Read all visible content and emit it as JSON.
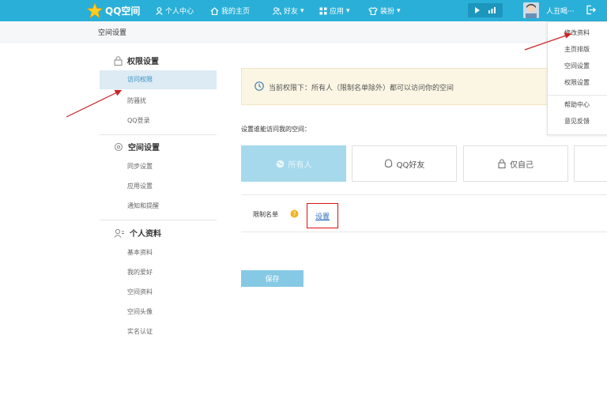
{
  "topbar": {
    "logo_text": "QQ空间",
    "nav": [
      {
        "label": "个人中心",
        "icon": "person-icon"
      },
      {
        "label": "我的主页",
        "icon": "home-icon"
      },
      {
        "label": "好友",
        "icon": "friends-icon"
      },
      {
        "label": "应用",
        "icon": "apps-grid-icon"
      },
      {
        "label": "装扮",
        "icon": "shirt-icon"
      }
    ],
    "username": "人丑喝···",
    "colors": {
      "bar": "#2ab0d8"
    }
  },
  "subheader": {
    "title": "空间设置"
  },
  "dropdown": {
    "items": [
      "修改资料",
      "主页排版",
      "空间设置",
      "权限设置",
      "帮助中心",
      "意见反馈"
    ]
  },
  "sidebar": {
    "groups": [
      {
        "title": "权限设置",
        "icon": "lock-icon",
        "items": [
          "访问权限",
          "防骚扰",
          "QQ登录"
        ]
      },
      {
        "title": "空间设置",
        "icon": "settings-icon",
        "items": [
          "同步设置",
          "应用设置",
          "通知和提醒"
        ]
      },
      {
        "title": "个人资料",
        "icon": "profile-icon",
        "items": [
          "基本资料",
          "我的爱好",
          "空间资料",
          "空间头像",
          "实名认证"
        ]
      }
    ],
    "active_item": "访问权限"
  },
  "main": {
    "notice": "当前权限下：所有人（限制名单除外）都可以访问你的空间",
    "section_label": "设置谁能访问我的空间：",
    "options": [
      {
        "label": "所有人",
        "icon": "globe-icon",
        "selected": true
      },
      {
        "label": "QQ好友",
        "icon": "friend-bubble-icon",
        "selected": false
      },
      {
        "label": "仅自己",
        "icon": "lock-icon",
        "selected": false
      }
    ],
    "limit_label": "限制名单",
    "set_link": "设置",
    "save_label": "保存"
  }
}
